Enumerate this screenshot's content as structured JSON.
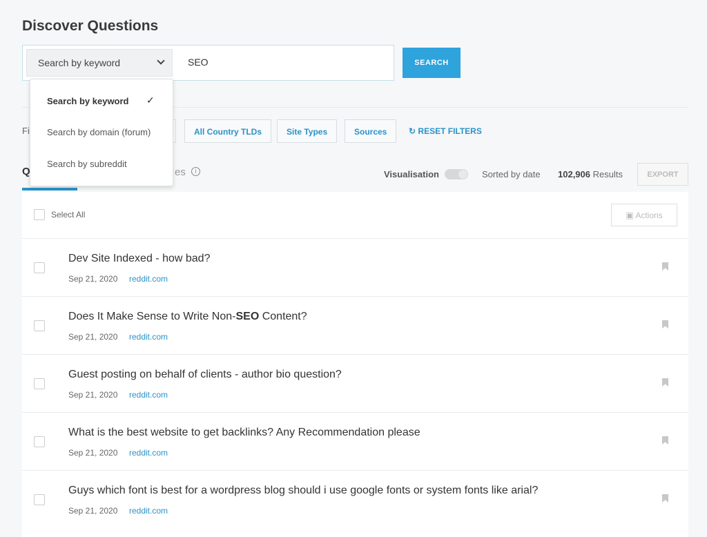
{
  "page_title": "Discover Questions",
  "search": {
    "mode": "Search by keyword",
    "query": "SEO",
    "button": "SEARCH",
    "options": [
      {
        "label": "Search by keyword",
        "selected": true
      },
      {
        "label": "Search by domain (forum)",
        "selected": false
      },
      {
        "label": "Search by subreddit",
        "selected": false
      }
    ]
  },
  "filters": {
    "label": "Fi",
    "buttons": [
      "All Country TLDs",
      "Site Types",
      "Sources"
    ],
    "reset": "RESET FILTERS"
  },
  "tabs": {
    "active": "Q",
    "second": "es"
  },
  "toolbar": {
    "visualisation": "Visualisation",
    "visualisation_on": false,
    "sorted": "Sorted by date",
    "count": "102,906",
    "count_suffix": "Results",
    "export": "EXPORT"
  },
  "list": {
    "select_all": "Select All",
    "actions": "Actions",
    "rows": [
      {
        "title_pre": "Dev Site Indexed - how bad?",
        "title_bold": "",
        "title_post": "",
        "date": "Sep 21, 2020",
        "source": "reddit.com"
      },
      {
        "title_pre": "Does It Make Sense to Write Non-",
        "title_bold": "SEO",
        "title_post": " Content?",
        "date": "Sep 21, 2020",
        "source": "reddit.com"
      },
      {
        "title_pre": "Guest posting on behalf of clients - author bio question?",
        "title_bold": "",
        "title_post": "",
        "date": "Sep 21, 2020",
        "source": "reddit.com"
      },
      {
        "title_pre": "What is the best website to get backlinks? Any Recommendation please",
        "title_bold": "",
        "title_post": "",
        "date": "Sep 21, 2020",
        "source": "reddit.com"
      },
      {
        "title_pre": "Guys which font is best for a wordpress blog should i use google fonts or system fonts like arial?",
        "title_bold": "",
        "title_post": "",
        "date": "Sep 21, 2020",
        "source": "reddit.com"
      }
    ]
  },
  "colors": {
    "accent": "#2ea3dc",
    "link": "#2a92c8"
  }
}
